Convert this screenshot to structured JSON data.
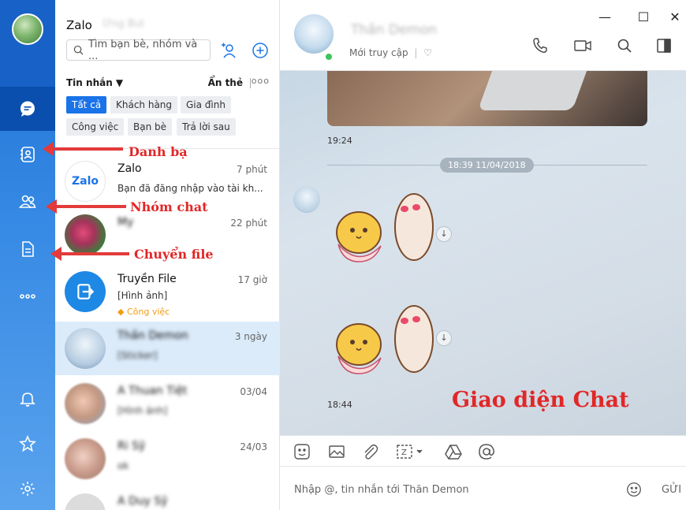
{
  "app": {
    "title": "Zalo",
    "user_name": "Ứng Bưi"
  },
  "search": {
    "placeholder": "Tìm bạn bè, nhóm và ..."
  },
  "list_header": {
    "messages_label": "Tin nhắn ▼",
    "hide_label": "Ẩn thẻ",
    "more_label": "ooo"
  },
  "filter_chips": [
    "Tất cả",
    "Khách hàng",
    "Gia đình",
    "Công việc",
    "Bạn bè",
    "Trả lời sau"
  ],
  "conversations": [
    {
      "name": "Zalo",
      "time": "7 phút",
      "preview": "Bạn đã đăng nhập vào tài kh..."
    },
    {
      "name": "My",
      "time": "22 phút",
      "preview": ""
    },
    {
      "name": "Truyền File",
      "time": "17 giờ",
      "preview": "[Hình ảnh]",
      "tag": "Công việc"
    },
    {
      "name": "Thần Demon",
      "time": "3 ngày",
      "preview": "[Sticker]"
    },
    {
      "name": "A Thuan Tiệt",
      "time": "03/04",
      "preview": "[Hình ảnh]"
    },
    {
      "name": "Ri Sỹ",
      "time": "24/03",
      "preview": "ok"
    },
    {
      "name": "A Duy Sỹ",
      "time": "",
      "preview": ""
    }
  ],
  "chat": {
    "contact_name": "Thần Demon",
    "status": "Mới truy cập",
    "time_1": "19:24",
    "date_divider": "18:39 11/04/2018",
    "time_2": "18:44",
    "compose_placeholder": "Nhập @, tin nhắn tới Thăn Demon",
    "send_label": "GỬI"
  },
  "window_controls": {
    "minimize": "—",
    "maximize": "☐",
    "close": "✕"
  },
  "annotations": {
    "contacts": "Danh bạ",
    "group_chat": "Nhóm chat",
    "file_transfer": "Chuyển file",
    "chat_ui": "Giao diện Chat"
  },
  "colors": {
    "accent": "#1a73e8",
    "annotation_red": "#e12727",
    "online": "#3bc65b"
  }
}
